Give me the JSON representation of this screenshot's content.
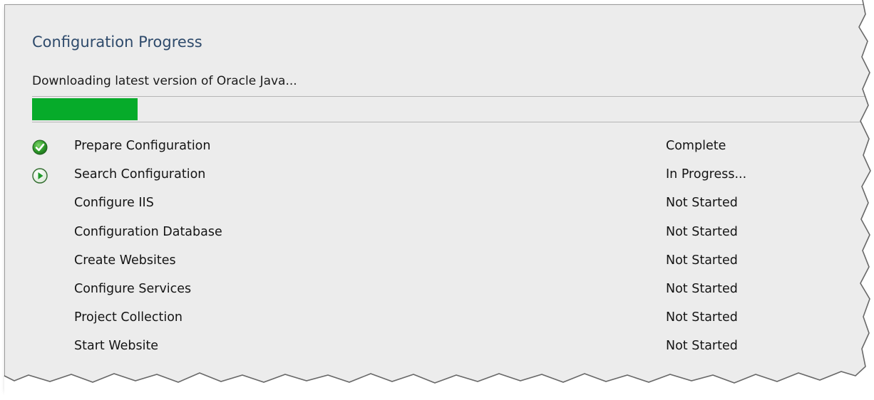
{
  "header": {
    "title": "Configuration Progress",
    "status_message": "Downloading latest version of Oracle Java..."
  },
  "progress": {
    "fraction": 0.125,
    "fill_color": "#06ab2a"
  },
  "steps": [
    {
      "label": "Prepare Configuration",
      "status": "Complete",
      "icon": "check-circle-icon"
    },
    {
      "label": "Search Configuration",
      "status": "In Progress...",
      "icon": "play-circle-icon"
    },
    {
      "label": "Configure IIS",
      "status": "Not Started",
      "icon": ""
    },
    {
      "label": "Configuration Database",
      "status": "Not Started",
      "icon": ""
    },
    {
      "label": "Create Websites",
      "status": "Not Started",
      "icon": ""
    },
    {
      "label": "Configure Services",
      "status": "Not Started",
      "icon": ""
    },
    {
      "label": "Project Collection",
      "status": "Not Started",
      "icon": ""
    },
    {
      "label": "Start Website",
      "status": "Not Started",
      "icon": ""
    }
  ]
}
